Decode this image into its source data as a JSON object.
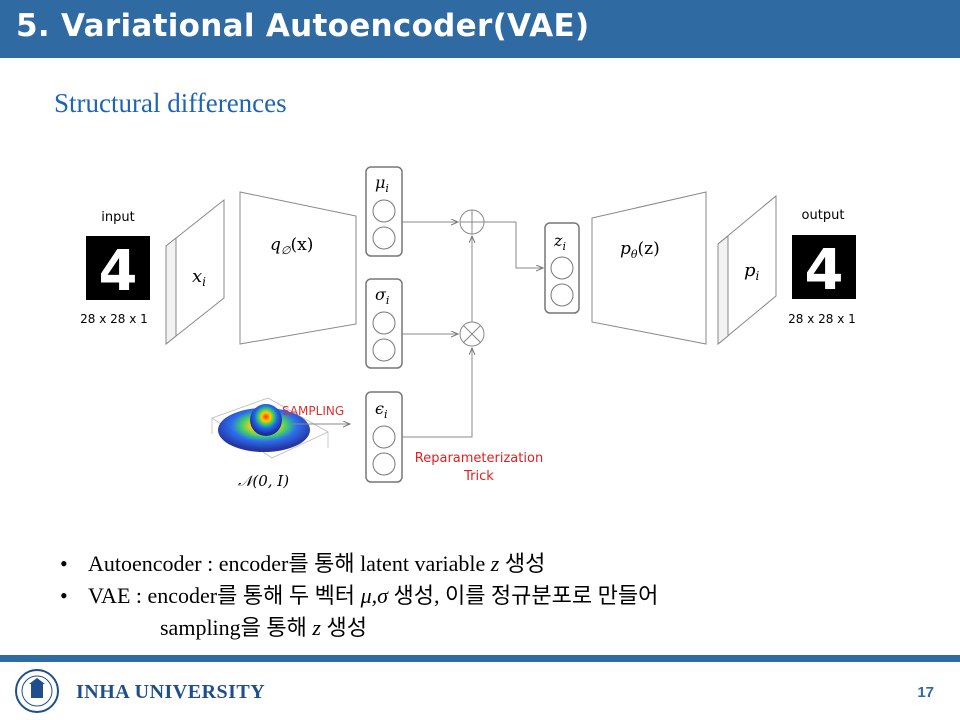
{
  "header": {
    "title": "5. Variational Autoencoder(VAE)"
  },
  "subtitle": "Structural differences",
  "diagram": {
    "input_label": "input",
    "input_size": "28 x 28 x 1",
    "x_var": "x",
    "x_sub": "i",
    "encoder_q": "q",
    "encoder_sub": "∅",
    "encoder_arg": "(x)",
    "mu_label": "μ",
    "mu_sub": "i",
    "sigma_label": "σ",
    "sigma_sub": "i",
    "eps_label": "ϵ",
    "eps_sub": "i",
    "z_label": "z",
    "z_sub": "i",
    "decoder_p": "p",
    "decoder_sub": "θ",
    "decoder_arg": "(z)",
    "p_var": "p",
    "p_sub": "i",
    "output_label": "output",
    "output_size": "28 x 28 x 1",
    "sampling_label": "SAMPLING",
    "normal_label": "𝒩(0, I)",
    "reparam_line1": "Reparameterization",
    "reparam_line2": "Trick",
    "digit": "4",
    "colors": {
      "accent": "#2f6aa3",
      "reparam": "#e02020",
      "sampling": "#e03030"
    }
  },
  "bullets": {
    "b1_prefix": "Autoencoder : encoder를 통해 latent variable ",
    "b1_var": "z",
    "b1_suffix": " 생성",
    "b2_prefix": "VAE : encoder를 통해 두 벡터 ",
    "b2_var": "μ,σ",
    "b2_suffix": " 생성, 이를 정규분포로 만들어",
    "b3_prefix": "sampling을 통해 ",
    "b3_var": "z",
    "b3_suffix": " 생성"
  },
  "footer": {
    "university": "INHA UNIVERSITY",
    "page": "17"
  }
}
